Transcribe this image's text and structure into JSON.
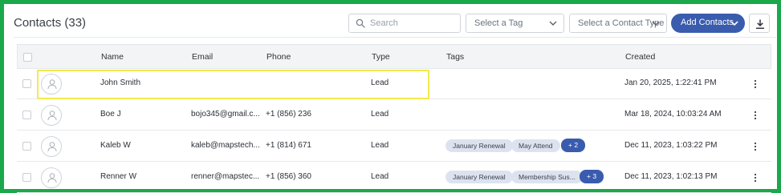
{
  "header": {
    "title": "Contacts (33)",
    "search_placeholder": "Search",
    "tag_select": "Select a Tag",
    "type_select": "Select a Contact Type",
    "add_button": "Add Contacts",
    "download_icon": "download-icon"
  },
  "table": {
    "columns": [
      "Name",
      "Email",
      "Phone",
      "Type",
      "Tags",
      "Created"
    ],
    "rows": [
      {
        "name": "John Smith",
        "email": "",
        "phone": "",
        "type": "Lead",
        "tags": [],
        "extra_tags": "",
        "created": "Jan 20, 2025, 1:22:41 PM"
      },
      {
        "name": "Boe J",
        "email": "bojo345@gmail.c...",
        "phone": "+1 (856) 236",
        "type": "Lead",
        "tags": [],
        "extra_tags": "",
        "created": "Mar 18, 2024, 10:03:24 AM"
      },
      {
        "name": "Kaleb W",
        "email": "kaleb@mapstech...",
        "phone": "+1 (814) 671",
        "type": "Lead",
        "tags": [
          "January Renewal",
          "May Attend"
        ],
        "extra_tags": "+ 2",
        "created": "Dec 11, 2023, 1:03:22 PM"
      },
      {
        "name": "Renner W",
        "email": "renner@mapstec...",
        "phone": "+1 (856) 360",
        "type": "Lead",
        "tags": [
          "January Renewal",
          "Membership Sus..."
        ],
        "extra_tags": "+ 3",
        "created": "Dec 11, 2023, 1:02:13 PM"
      }
    ]
  },
  "colors": {
    "frame_border": "#1aa84b",
    "accent": "#3a5cae",
    "highlight": "#f2e94e"
  }
}
